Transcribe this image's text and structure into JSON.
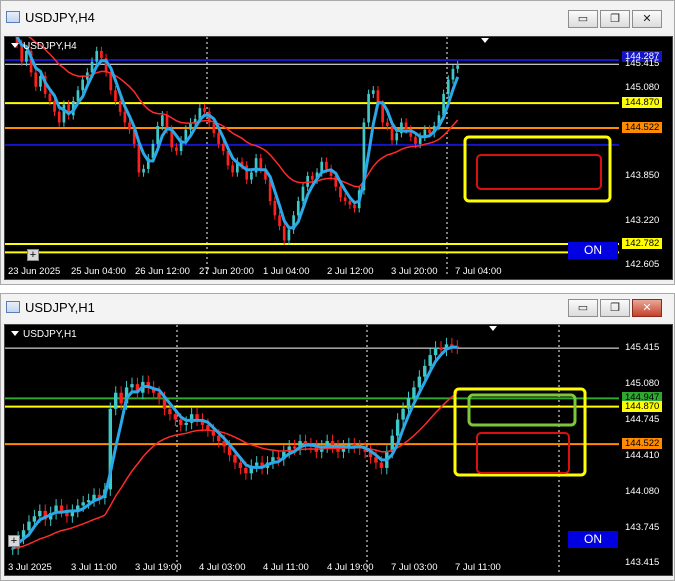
{
  "windows": [
    {
      "id": "h4",
      "title": "USDJPY,H4",
      "chart_label": "USDJPY,H4",
      "on_label": "ON",
      "price_labels": [
        "144.287",
        "145.415",
        "145.080",
        "144.870",
        "144.522",
        "143.850",
        "143.220",
        "142.782",
        "142.605"
      ],
      "x_labels": [
        "23 Jun 2025",
        "25 Jun 04:00",
        "26 Jun 12:00",
        "27 Jun 20:00",
        "1 Jul 04:00",
        "2 Jul 12:00",
        "3 Jul 20:00",
        "7 Jul 04:00"
      ]
    },
    {
      "id": "h1",
      "title": "USDJPY,H1",
      "chart_label": "USDJPY,H1",
      "on_label": "ON",
      "price_labels": [
        "145.415",
        "145.080",
        "144.947",
        "144.870",
        "144.745",
        "144.522",
        "144.410",
        "144.080",
        "143.745",
        "143.415"
      ],
      "x_labels": [
        "3 Jul 2025",
        "3 Jul 11:00",
        "3 Jul 19:00",
        "4 Jul 03:00",
        "4 Jul 11:00",
        "4 Jul 19:00",
        "7 Jul 03:00",
        "7 Jul 11:00"
      ]
    }
  ],
  "window_buttons": {
    "minimize": "▭",
    "restore": "❐",
    "close": "✕"
  },
  "colors": {
    "background": "#000000",
    "bull": "#3fc8c8",
    "bear": "#ff2020",
    "ma_red": "#ff2a2a",
    "ma_blue": "#2aa8e8",
    "yellow": "#ffff00",
    "orange": "#ff8c00",
    "green": "#2ea82e",
    "blue_level": "#1414c8"
  },
  "chart_data": [
    {
      "type": "candlestick",
      "title": "USDJPY,H4",
      "ylim": [
        142.605,
        145.6
      ],
      "y_ticks": [
        142.605,
        143.22,
        143.85,
        144.522,
        144.87,
        145.08,
        145.415
      ],
      "x_ticks": [
        "23 Jun 2025",
        "25 Jun 04:00",
        "26 Jun 12:00",
        "27 Jun 20:00",
        "1 Jul 04:00",
        "2 Jul 12:00",
        "3 Jul 20:00",
        "7 Jul 04:00"
      ],
      "levels": [
        {
          "price": 144.287,
          "color": "#1414c8",
          "label": "144.287"
        },
        {
          "price": 145.415,
          "color": "#ffffff",
          "label": "145.415"
        },
        {
          "price": 144.87,
          "color": "#ffff00",
          "label": "144.870"
        },
        {
          "price": 144.522,
          "color": "#ff8c00",
          "label": "144.522"
        },
        {
          "price": 142.782,
          "color": "#ffff00",
          "label": "142.782"
        }
      ],
      "closes": [
        145.9,
        145.7,
        145.45,
        145.6,
        145.3,
        145.1,
        145.25,
        145.0,
        144.9,
        144.75,
        144.6,
        144.85,
        144.7,
        144.9,
        145.05,
        145.2,
        145.3,
        145.45,
        145.6,
        145.5,
        145.3,
        145.05,
        144.9,
        144.75,
        144.6,
        144.5,
        144.3,
        143.9,
        143.95,
        144.1,
        144.3,
        144.55,
        144.7,
        144.5,
        144.25,
        144.2,
        144.35,
        144.5,
        144.6,
        144.65,
        144.8,
        144.75,
        144.6,
        144.45,
        144.3,
        144.2,
        144.0,
        143.9,
        144.05,
        144.0,
        143.8,
        143.9,
        144.1,
        143.95,
        143.8,
        143.5,
        143.3,
        143.15,
        142.95,
        143.1,
        143.3,
        143.5,
        143.7,
        143.85,
        143.8,
        143.9,
        144.05,
        143.95,
        143.85,
        143.7,
        143.55,
        143.5,
        143.45,
        143.4,
        143.65,
        144.6,
        145.0,
        145.05,
        144.85,
        144.6,
        144.55,
        144.35,
        144.45,
        144.6,
        144.5,
        144.4,
        144.3,
        144.4,
        144.5,
        144.45,
        144.55,
        144.7,
        145.0,
        145.2,
        145.35,
        145.4
      ]
    },
    {
      "type": "candlestick",
      "title": "USDJPY,H1",
      "ylim": [
        143.415,
        145.5
      ],
      "y_ticks": [
        143.415,
        143.745,
        144.08,
        144.41,
        144.522,
        144.745,
        144.87,
        144.947,
        145.08,
        145.415
      ],
      "x_ticks": [
        "3 Jul 2025",
        "3 Jul 11:00",
        "3 Jul 19:00",
        "4 Jul 03:00",
        "4 Jul 11:00",
        "4 Jul 19:00",
        "7 Jul 03:00",
        "7 Jul 11:00"
      ],
      "levels": [
        {
          "price": 145.415,
          "color": "#ffffff",
          "label": "145.415"
        },
        {
          "price": 144.947,
          "color": "#2ea82e",
          "label": "144.947"
        },
        {
          "price": 144.87,
          "color": "#ffff00",
          "label": "144.870"
        },
        {
          "price": 144.522,
          "color": "#ff8c00",
          "label": "144.522"
        }
      ],
      "closes": [
        143.55,
        143.65,
        143.72,
        143.8,
        143.85,
        143.9,
        143.82,
        143.88,
        143.95,
        143.9,
        143.85,
        143.9,
        143.95,
        143.98,
        144.0,
        144.05,
        144.02,
        144.1,
        144.85,
        145.0,
        144.9,
        145.05,
        145.08,
        145.0,
        145.1,
        145.05,
        145.0,
        144.95,
        144.85,
        144.8,
        144.75,
        144.7,
        144.72,
        144.8,
        144.75,
        144.7,
        144.65,
        144.6,
        144.55,
        144.5,
        144.42,
        144.35,
        144.3,
        144.25,
        144.32,
        144.35,
        144.3,
        144.35,
        144.4,
        144.38,
        144.45,
        144.5,
        144.48,
        144.55,
        144.52,
        144.5,
        144.45,
        144.5,
        144.55,
        144.5,
        144.45,
        144.5,
        144.52,
        144.5,
        144.48,
        144.45,
        144.4,
        144.35,
        144.3,
        144.45,
        144.6,
        144.75,
        144.85,
        144.95,
        145.05,
        145.15,
        145.25,
        145.35,
        145.42,
        145.4,
        145.45,
        145.43,
        145.42
      ]
    }
  ]
}
